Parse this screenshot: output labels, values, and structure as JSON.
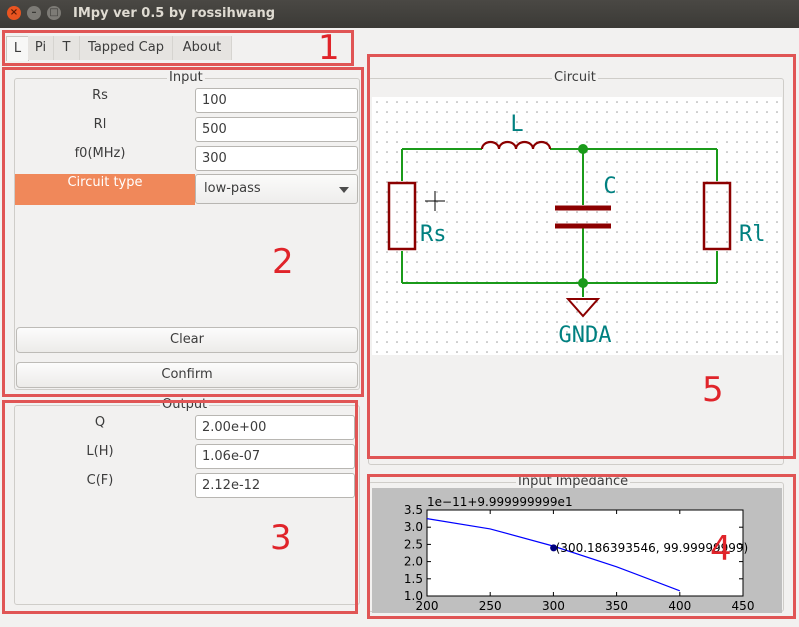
{
  "window": {
    "title": "IMpy ver 0.5 by rossihwang",
    "close_glyph": "×",
    "min_glyph": "–",
    "max_glyph": "□"
  },
  "tabs": [
    "L",
    "Pi",
    "T",
    "Tapped Cap",
    "About"
  ],
  "active_tab": "L",
  "annotations": [
    "1",
    "2",
    "3",
    "4",
    "5"
  ],
  "input": {
    "title": "Input",
    "rs_label": "Rs",
    "rs_value": "100",
    "rl_label": "Rl",
    "rl_value": "500",
    "f0_label": "f0(MHz)",
    "f0_value": "300",
    "circuit_type_label": "Circuit type",
    "circuit_type_value": "low-pass",
    "clear_label": "Clear",
    "confirm_label": "Confirm"
  },
  "output": {
    "title": "Output",
    "q_label": "Q",
    "q_value": "2.00e+00",
    "l_label": "L(H)",
    "l_value": "1.06e-07",
    "c_label": "C(F)",
    "c_value": "2.12e-12"
  },
  "circuit": {
    "title": "Circuit",
    "labels": {
      "L": "L",
      "C": "C",
      "Rs": "Rs",
      "Rl": "Rl",
      "gnd": "GNDA"
    },
    "wire_color": "#1a9a1a",
    "component_color": "#8b0000",
    "text_color": "#008080"
  },
  "chart_data": {
    "type": "line",
    "title": "Input Impedance",
    "offset_text": "1e−11+9.999999999e1",
    "xlim": [
      200,
      450
    ],
    "ylim": [
      1.0,
      3.5
    ],
    "xticks": [
      "200",
      "250",
      "300",
      "350",
      "400",
      "450"
    ],
    "yticks": [
      "1.0",
      "1.5",
      "2.0",
      "2.5",
      "3.0",
      "3.5"
    ],
    "series": [
      {
        "x": [
          200,
          250,
          300,
          350,
          400
        ],
        "y": [
          3.25,
          2.95,
          2.45,
          1.85,
          1.15
        ],
        "color": "#0000ff"
      }
    ],
    "marker": {
      "x": 300.186393546,
      "y": 2.4,
      "label": "(300.186393546, 99.99999999)"
    }
  }
}
